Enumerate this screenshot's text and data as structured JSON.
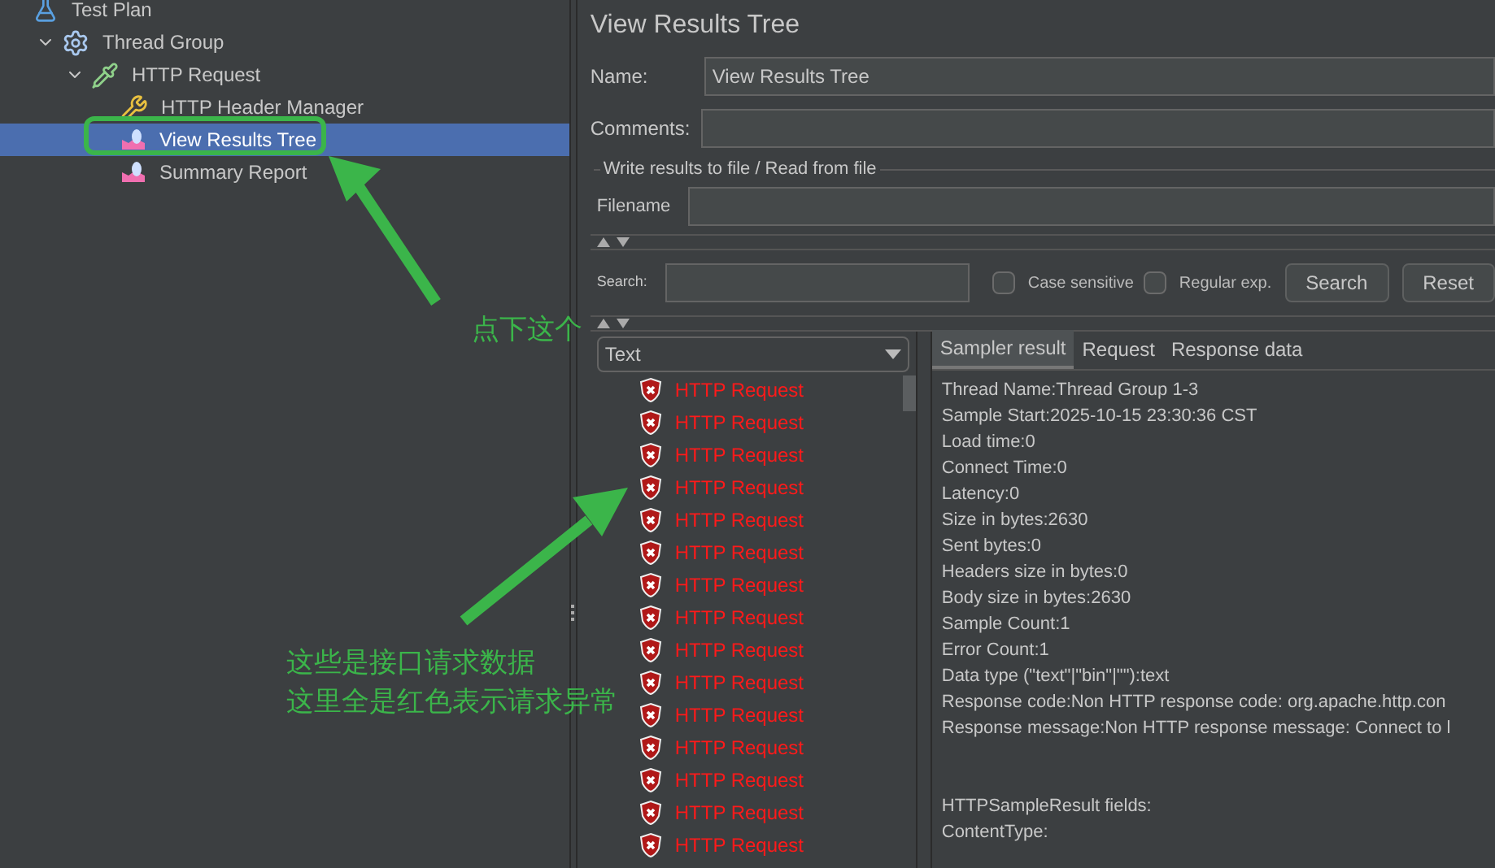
{
  "tree": [
    {
      "label": "Test Plan",
      "kind": "plan",
      "selected": false,
      "children": [
        {
          "label": "Thread Group",
          "kind": "thread-group",
          "selected": false,
          "expanded": true,
          "children": [
            {
              "label": "HTTP Request",
              "kind": "sampler",
              "selected": false,
              "expanded": true,
              "children": [
                {
                  "label": "HTTP Header Manager",
                  "kind": "config",
                  "selected": false
                },
                {
                  "label": "View Results Tree",
                  "kind": "listener",
                  "selected": true
                },
                {
                  "label": "Summary Report",
                  "kind": "listener",
                  "selected": false
                }
              ]
            }
          ]
        }
      ]
    }
  ],
  "panel": {
    "title": "View Results Tree",
    "name_label": "Name:",
    "name_value": "View Results Tree",
    "comments_label": "Comments:",
    "file_group": "Write results to file / Read from file",
    "filename_label": "Filename",
    "search_label": "Search:",
    "case_sensitive": {
      "label": "Case sensitive",
      "checked": false
    },
    "regex": {
      "label": "Regular exp.",
      "checked": false
    },
    "buttons": [
      "Search",
      "Reset"
    ]
  },
  "renderer": "Text",
  "results": [
    {
      "label": "HTTP Request",
      "success": false
    },
    {
      "label": "HTTP Request",
      "success": false
    },
    {
      "label": "HTTP Request",
      "success": false
    },
    {
      "label": "HTTP Request",
      "success": false
    },
    {
      "label": "HTTP Request",
      "success": false
    },
    {
      "label": "HTTP Request",
      "success": false
    },
    {
      "label": "HTTP Request",
      "success": false
    },
    {
      "label": "HTTP Request",
      "success": false
    },
    {
      "label": "HTTP Request",
      "success": false
    },
    {
      "label": "HTTP Request",
      "success": false
    },
    {
      "label": "HTTP Request",
      "success": false
    },
    {
      "label": "HTTP Request",
      "success": false
    },
    {
      "label": "HTTP Request",
      "success": false
    },
    {
      "label": "HTTP Request",
      "success": false
    },
    {
      "label": "HTTP Request",
      "success": false
    }
  ],
  "detail_tabs": [
    {
      "label": "Sampler result",
      "selected": true
    },
    {
      "label": "Request",
      "selected": false
    },
    {
      "label": "Response data",
      "selected": false
    }
  ],
  "sampler_result": [
    "Thread Name:Thread Group 1-3",
    "Sample Start:2025-10-15 23:30:36 CST",
    "Load time:0",
    "Connect Time:0",
    "Latency:0",
    "Size in bytes:2630",
    "Sent bytes:0",
    "Headers size in bytes:0",
    "Body size in bytes:2630",
    "Sample Count:1",
    "Error Count:1",
    "Data type (\"text\"|\"bin\"|\"\"):text",
    "Response code:Non HTTP response code: org.apache.http.con",
    "Response message:Non HTTP response message: Connect to l",
    "HTTPSampleResult fields:",
    "ContentType:"
  ],
  "annotations": [
    "点下这个",
    "这些是接口请求数据",
    "这里全是红色表示请求异常"
  ]
}
